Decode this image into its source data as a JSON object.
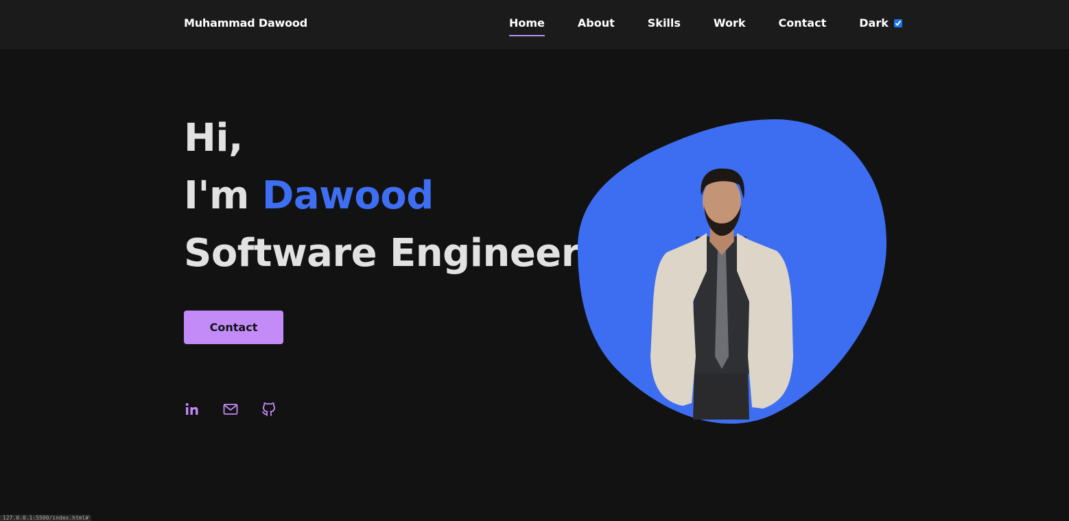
{
  "header": {
    "brand": "Muhammad Dawood",
    "nav": [
      {
        "label": "Home",
        "active": true
      },
      {
        "label": "About",
        "active": false
      },
      {
        "label": "Skills",
        "active": false
      },
      {
        "label": "Work",
        "active": false
      },
      {
        "label": "Contact",
        "active": false
      }
    ],
    "theme_toggle": {
      "label": "Dark",
      "checked": true
    }
  },
  "hero": {
    "greeting": "Hi,",
    "intro_prefix": "I'm ",
    "name": "Dawood",
    "title": "Software Engineer",
    "contact_button": "Contact",
    "socials": [
      {
        "icon": "linkedin-icon"
      },
      {
        "icon": "mail-icon"
      },
      {
        "icon": "github-icon"
      }
    ]
  },
  "status_bar": {
    "url": "127.0.0.1:5500/index.html#"
  },
  "colors": {
    "background": "#121212",
    "navbar": "#1b1b1b",
    "accent_purple": "#c28bf8",
    "highlight_blue": "#3e6ef2",
    "blob_blue": "#3d6ef2"
  }
}
